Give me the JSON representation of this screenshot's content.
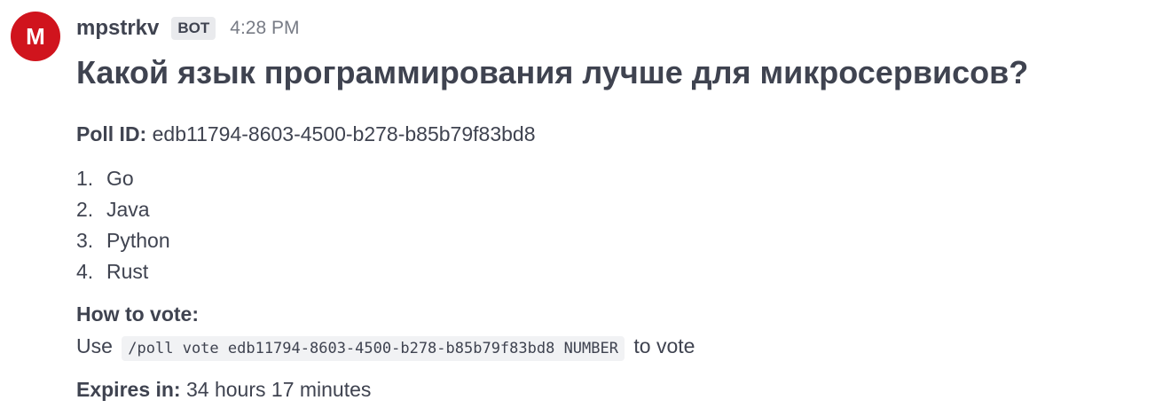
{
  "post": {
    "avatar_letter": "M",
    "username": "mpstrkv",
    "badge": "BOT",
    "time": "4:28 PM",
    "title": "Какой язык программирования лучше для микросервисов?",
    "poll_id_label": "Poll ID:",
    "poll_id": "edb11794-8603-4500-b278-b85b79f83bd8",
    "options": [
      {
        "num": "1.",
        "label": "Go"
      },
      {
        "num": "2.",
        "label": "Java"
      },
      {
        "num": "3.",
        "label": "Python"
      },
      {
        "num": "4.",
        "label": "Rust"
      }
    ],
    "how_to_vote_label": "How to vote:",
    "use_text": "Use",
    "command": "/poll vote edb11794-8603-4500-b278-b85b79f83bd8 NUMBER",
    "to_vote_text": "to vote",
    "expires_label": "Expires in:",
    "expires_value": "34 hours 17 minutes"
  },
  "colors": {
    "avatar_bg": "#d0141d",
    "text": "#3f4350",
    "muted": "#777b85",
    "badge_bg": "#e9eaed",
    "code_bg": "#f1f2f4"
  }
}
